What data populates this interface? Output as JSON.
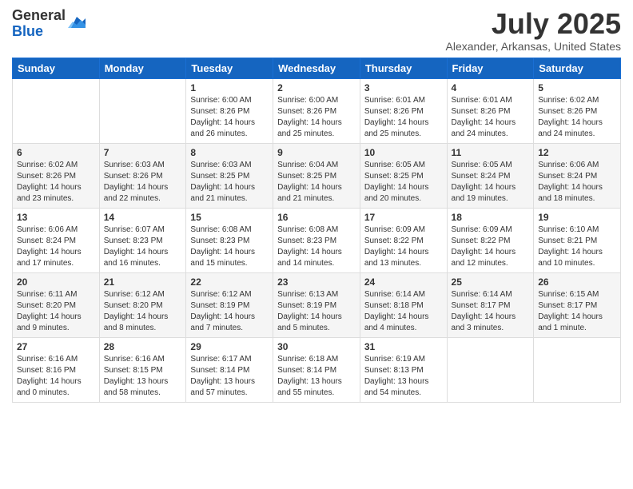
{
  "logo": {
    "general": "General",
    "blue": "Blue"
  },
  "header": {
    "month_year": "July 2025",
    "location": "Alexander, Arkansas, United States"
  },
  "weekdays": [
    "Sunday",
    "Monday",
    "Tuesday",
    "Wednesday",
    "Thursday",
    "Friday",
    "Saturday"
  ],
  "weeks": [
    [
      {
        "day": "",
        "info": ""
      },
      {
        "day": "",
        "info": ""
      },
      {
        "day": "1",
        "info": "Sunrise: 6:00 AM\nSunset: 8:26 PM\nDaylight: 14 hours and 26 minutes."
      },
      {
        "day": "2",
        "info": "Sunrise: 6:00 AM\nSunset: 8:26 PM\nDaylight: 14 hours and 25 minutes."
      },
      {
        "day": "3",
        "info": "Sunrise: 6:01 AM\nSunset: 8:26 PM\nDaylight: 14 hours and 25 minutes."
      },
      {
        "day": "4",
        "info": "Sunrise: 6:01 AM\nSunset: 8:26 PM\nDaylight: 14 hours and 24 minutes."
      },
      {
        "day": "5",
        "info": "Sunrise: 6:02 AM\nSunset: 8:26 PM\nDaylight: 14 hours and 24 minutes."
      }
    ],
    [
      {
        "day": "6",
        "info": "Sunrise: 6:02 AM\nSunset: 8:26 PM\nDaylight: 14 hours and 23 minutes."
      },
      {
        "day": "7",
        "info": "Sunrise: 6:03 AM\nSunset: 8:26 PM\nDaylight: 14 hours and 22 minutes."
      },
      {
        "day": "8",
        "info": "Sunrise: 6:03 AM\nSunset: 8:25 PM\nDaylight: 14 hours and 21 minutes."
      },
      {
        "day": "9",
        "info": "Sunrise: 6:04 AM\nSunset: 8:25 PM\nDaylight: 14 hours and 21 minutes."
      },
      {
        "day": "10",
        "info": "Sunrise: 6:05 AM\nSunset: 8:25 PM\nDaylight: 14 hours and 20 minutes."
      },
      {
        "day": "11",
        "info": "Sunrise: 6:05 AM\nSunset: 8:24 PM\nDaylight: 14 hours and 19 minutes."
      },
      {
        "day": "12",
        "info": "Sunrise: 6:06 AM\nSunset: 8:24 PM\nDaylight: 14 hours and 18 minutes."
      }
    ],
    [
      {
        "day": "13",
        "info": "Sunrise: 6:06 AM\nSunset: 8:24 PM\nDaylight: 14 hours and 17 minutes."
      },
      {
        "day": "14",
        "info": "Sunrise: 6:07 AM\nSunset: 8:23 PM\nDaylight: 14 hours and 16 minutes."
      },
      {
        "day": "15",
        "info": "Sunrise: 6:08 AM\nSunset: 8:23 PM\nDaylight: 14 hours and 15 minutes."
      },
      {
        "day": "16",
        "info": "Sunrise: 6:08 AM\nSunset: 8:23 PM\nDaylight: 14 hours and 14 minutes."
      },
      {
        "day": "17",
        "info": "Sunrise: 6:09 AM\nSunset: 8:22 PM\nDaylight: 14 hours and 13 minutes."
      },
      {
        "day": "18",
        "info": "Sunrise: 6:09 AM\nSunset: 8:22 PM\nDaylight: 14 hours and 12 minutes."
      },
      {
        "day": "19",
        "info": "Sunrise: 6:10 AM\nSunset: 8:21 PM\nDaylight: 14 hours and 10 minutes."
      }
    ],
    [
      {
        "day": "20",
        "info": "Sunrise: 6:11 AM\nSunset: 8:20 PM\nDaylight: 14 hours and 9 minutes."
      },
      {
        "day": "21",
        "info": "Sunrise: 6:12 AM\nSunset: 8:20 PM\nDaylight: 14 hours and 8 minutes."
      },
      {
        "day": "22",
        "info": "Sunrise: 6:12 AM\nSunset: 8:19 PM\nDaylight: 14 hours and 7 minutes."
      },
      {
        "day": "23",
        "info": "Sunrise: 6:13 AM\nSunset: 8:19 PM\nDaylight: 14 hours and 5 minutes."
      },
      {
        "day": "24",
        "info": "Sunrise: 6:14 AM\nSunset: 8:18 PM\nDaylight: 14 hours and 4 minutes."
      },
      {
        "day": "25",
        "info": "Sunrise: 6:14 AM\nSunset: 8:17 PM\nDaylight: 14 hours and 3 minutes."
      },
      {
        "day": "26",
        "info": "Sunrise: 6:15 AM\nSunset: 8:17 PM\nDaylight: 14 hours and 1 minute."
      }
    ],
    [
      {
        "day": "27",
        "info": "Sunrise: 6:16 AM\nSunset: 8:16 PM\nDaylight: 14 hours and 0 minutes."
      },
      {
        "day": "28",
        "info": "Sunrise: 6:16 AM\nSunset: 8:15 PM\nDaylight: 13 hours and 58 minutes."
      },
      {
        "day": "29",
        "info": "Sunrise: 6:17 AM\nSunset: 8:14 PM\nDaylight: 13 hours and 57 minutes."
      },
      {
        "day": "30",
        "info": "Sunrise: 6:18 AM\nSunset: 8:14 PM\nDaylight: 13 hours and 55 minutes."
      },
      {
        "day": "31",
        "info": "Sunrise: 6:19 AM\nSunset: 8:13 PM\nDaylight: 13 hours and 54 minutes."
      },
      {
        "day": "",
        "info": ""
      },
      {
        "day": "",
        "info": ""
      }
    ]
  ]
}
